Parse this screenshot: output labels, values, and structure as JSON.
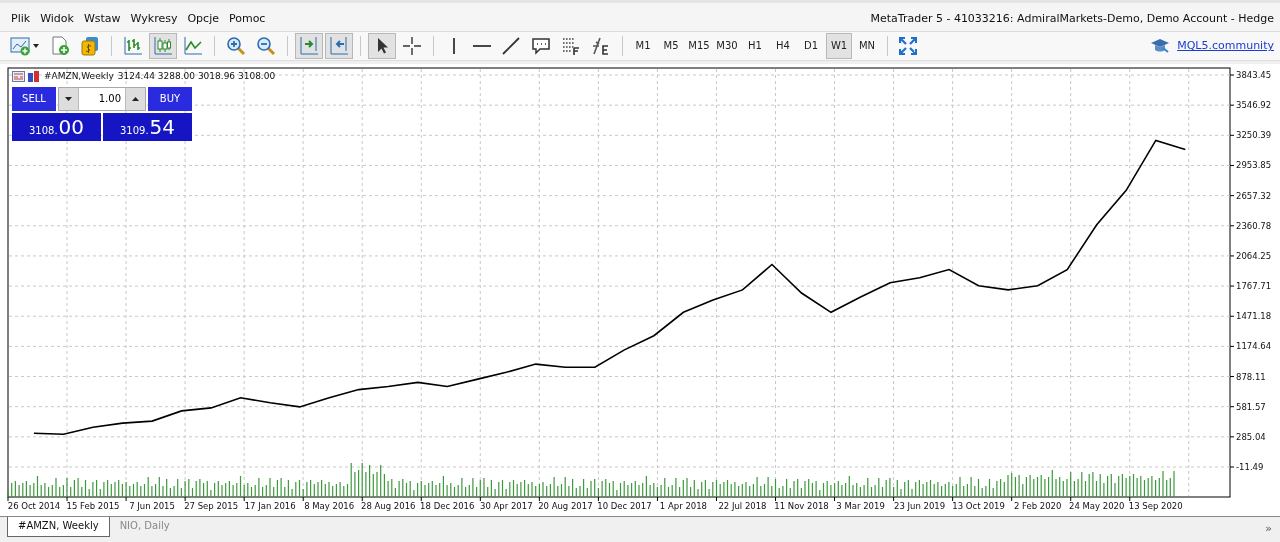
{
  "window": {
    "title": "MetaTrader 5 - 41033216: AdmiralMarkets-Demo, Demo Account - Hedge"
  },
  "menu": [
    "Plik",
    "Widok",
    "Wstaw",
    "Wykresy",
    "Opcje",
    "Pomoc"
  ],
  "toolbar": {
    "groups": [
      [
        {
          "kind": "newchart",
          "pressed": false
        },
        {
          "kind": "newfile",
          "pressed": false
        },
        {
          "kind": "money",
          "pressed": false
        }
      ],
      [
        {
          "kind": "bars",
          "pressed": false
        },
        {
          "kind": "candles",
          "pressed": true
        },
        {
          "kind": "line",
          "pressed": false
        }
      ],
      [
        {
          "kind": "zoomin",
          "pressed": false
        },
        {
          "kind": "zoomout",
          "pressed": false
        }
      ],
      [
        {
          "kind": "autoscroll",
          "pressed": true
        },
        {
          "kind": "shift",
          "pressed": true
        }
      ],
      [
        {
          "kind": "cursor",
          "pressed": true
        },
        {
          "kind": "crosshair",
          "pressed": false
        }
      ],
      [
        {
          "kind": "vline",
          "pressed": false
        },
        {
          "kind": "hline",
          "pressed": false
        },
        {
          "kind": "trend",
          "pressed": false
        },
        {
          "kind": "text",
          "pressed": false
        },
        {
          "kind": "fibo",
          "pressed": false
        },
        {
          "kind": "indicators",
          "pressed": false
        }
      ]
    ],
    "timeframes": [
      {
        "label": "M1",
        "selected": false
      },
      {
        "label": "M5",
        "selected": false
      },
      {
        "label": "M15",
        "selected": false
      },
      {
        "label": "M30",
        "selected": false
      },
      {
        "label": "H1",
        "selected": false
      },
      {
        "label": "H4",
        "selected": false
      },
      {
        "label": "D1",
        "selected": false
      },
      {
        "label": "W1",
        "selected": true
      },
      {
        "label": "MN",
        "selected": false
      }
    ],
    "community_link": "MQL5.community"
  },
  "chart": {
    "symbol": "#AMZN,Weekly",
    "ohlc": "3124.44 3288.00 3018.96 3108.00",
    "trade_panel": {
      "sell_label": "SELL",
      "buy_label": "BUY",
      "volume": "1.00",
      "sell_price": "3108.",
      "sell_price_big": "00",
      "buy_price": "3109.",
      "buy_price_big": "54"
    },
    "chart_data": {
      "type": "line",
      "grid": true,
      "ylim": [
        -11.49,
        3843.45
      ],
      "categories": [
        "26 Oct 2014",
        null,
        "15 Feb 2015",
        null,
        "7 Jun 2015",
        null,
        "27 Sep 2015",
        null,
        "17 Jan 2016",
        null,
        "8 May 2016",
        null,
        "28 Aug 2016",
        null,
        "18 Dec 2016",
        null,
        "30 Apr 2017",
        null,
        "20 Aug 2017",
        null,
        "10 Dec 2017",
        null,
        "1 Apr 2018",
        null,
        "22 Jul 2018",
        null,
        "11 Nov 2018",
        null,
        "3 Mar 2019",
        null,
        "23 Jun 2019",
        null,
        "13 Oct 2019",
        null,
        "2 Feb 2020",
        null,
        "24 May 2020",
        null,
        "13 Sep 2020",
        null
      ],
      "series": [
        {
          "color": "#000000",
          "values": [
            320,
            310,
            380,
            420,
            440,
            540,
            570,
            670,
            620,
            580,
            670,
            750,
            780,
            820,
            780,
            850,
            920,
            1000,
            970,
            970,
            1140,
            1280,
            1510,
            1630,
            1730,
            1980,
            1700,
            1510,
            1660,
            1800,
            1850,
            1930,
            1770,
            1730,
            1770,
            1930,
            2370,
            2710,
            3200,
            3110
          ]
        }
      ],
      "yticks": [
        3843.45,
        3546.92,
        3250.39,
        2953.85,
        2657.32,
        2360.78,
        2064.25,
        1767.71,
        1471.18,
        1174.64,
        878.11,
        581.57,
        285.04,
        -11.49
      ]
    }
  },
  "tabs": [
    {
      "label": "#AMZN, Weekly",
      "selected": true
    },
    {
      "label": "NIO, Daily",
      "selected": false
    }
  ],
  "more_tabs": "»"
}
